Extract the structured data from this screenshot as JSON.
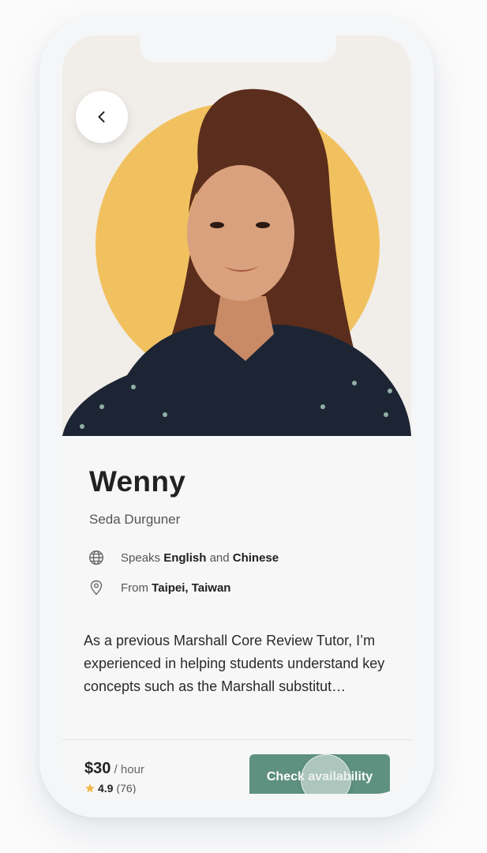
{
  "profile": {
    "name": "Wenny",
    "subtitle": "Seda Durguner",
    "speaks_prefix": "Speaks",
    "language_1": "English",
    "speaks_and": "and",
    "language_2": "Chinese",
    "from_prefix": "From",
    "location": "Taipei, Taiwan",
    "bio": "As a previous Marshall Core Review Tutor, I’m experienced in helping students understand key concepts such as the Marshall substitut…"
  },
  "booking": {
    "price": "$30",
    "price_unit": "/ hour",
    "rating": "4.9",
    "review_count": "(76)",
    "cta_label": "Check availability"
  },
  "icons": {
    "back": "chevron-left-icon",
    "language": "globe-icon",
    "location": "map-pin-icon",
    "rating": "star-icon"
  },
  "colors": {
    "accent": "#5e9180",
    "circle": "#f2c15f",
    "star": "#f2b94a"
  }
}
